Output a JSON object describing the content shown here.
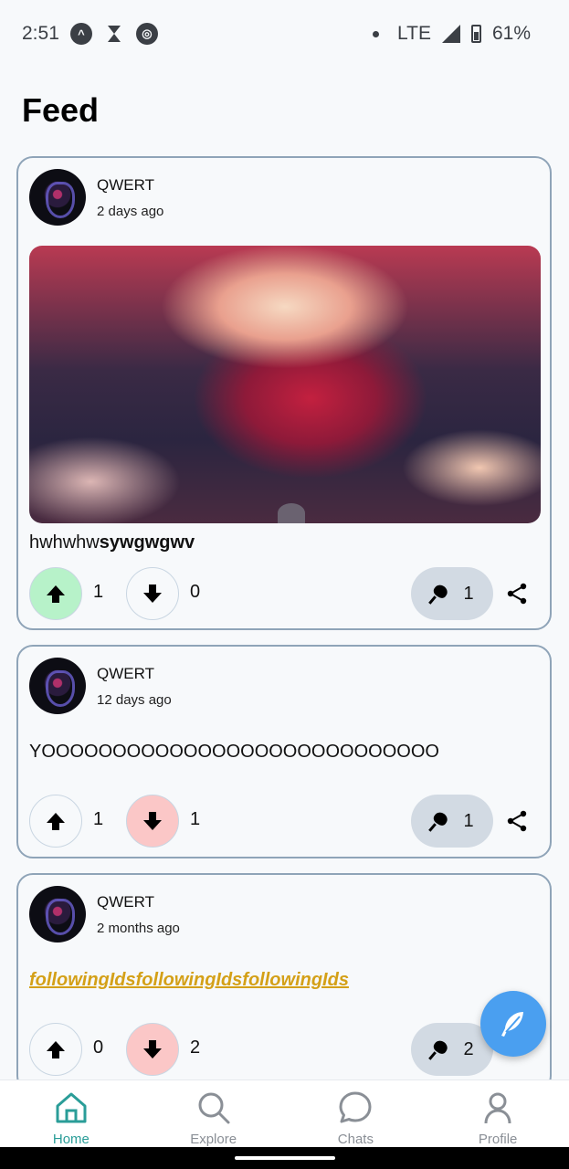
{
  "status_bar": {
    "time": "2:51",
    "network": "LTE",
    "battery": "61%"
  },
  "page": {
    "title": "Feed"
  },
  "posts": [
    {
      "author": "QWERT",
      "time": "2 days ago",
      "has_image": true,
      "text_plain": "hwhwhw",
      "text_bold": "sywgwgwv",
      "upvotes": "1",
      "downvotes": "0",
      "pins": "1",
      "vote_state": "up"
    },
    {
      "author": "QWERT",
      "time": "12 days ago",
      "text_plain": "YOOOOOOOOOOOOOOOOOOOOOOOOOOOO",
      "upvotes": "1",
      "downvotes": "1",
      "pins": "1",
      "vote_state": "down"
    },
    {
      "author": "QWERT",
      "time": "2 months ago",
      "text_link": "followingIdsfollowingIdsfollowingIds",
      "upvotes": "0",
      "downvotes": "2",
      "pins": "2",
      "vote_state": "down"
    }
  ],
  "bottom_nav": {
    "items": [
      {
        "label": "Home",
        "icon": "home-icon",
        "active": true
      },
      {
        "label": "Explore",
        "icon": "search-icon",
        "active": false
      },
      {
        "label": "Chats",
        "icon": "chat-bubble-icon",
        "active": false
      },
      {
        "label": "Profile",
        "icon": "person-icon",
        "active": false
      }
    ]
  },
  "fab": {
    "icon": "feather-icon"
  },
  "colors": {
    "accent": "#2a9d98",
    "fab": "#4a9ff0",
    "upvote_active": "#b7f2c9",
    "downvote_active": "#fbc7c7",
    "link": "#d4a017",
    "card_border": "#8fa4b8"
  }
}
